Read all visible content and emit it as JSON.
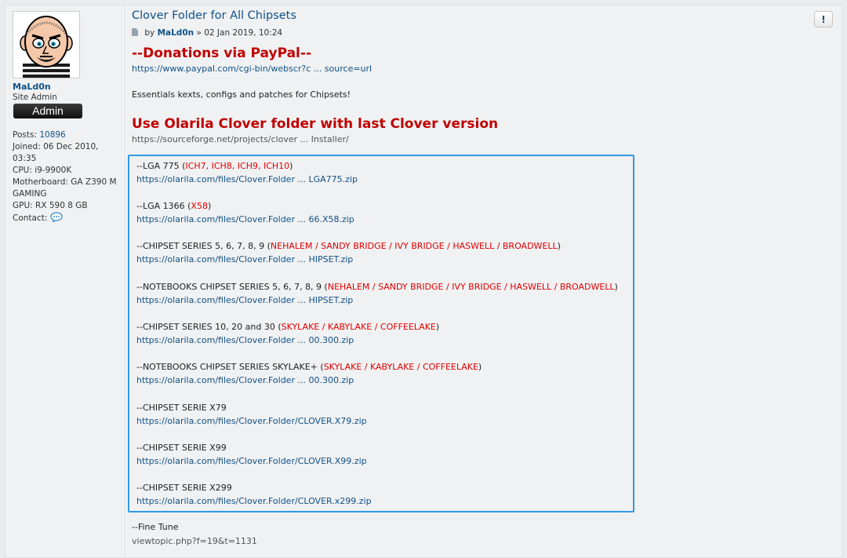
{
  "profile": {
    "username": "MaLd0n",
    "rank_title": "Site Admin",
    "rank_badge": "Admin",
    "posts_label": "Posts:",
    "posts_value": "10896",
    "joined": "Joined: 06 Dec 2010, 03:35",
    "cpu": "CPU: i9-9900K",
    "motherboard": "Motherboard: GA Z390 M GAMING",
    "gpu": "GPU: RX 590 8 GB",
    "contact_label": "Contact:"
  },
  "post": {
    "title": "Clover Folder for All Chipsets",
    "by": "by",
    "author": "MaLd0n",
    "date": "» 02 Jan 2019, 10:24",
    "report_label": "!",
    "donations_heading": "--Donations via PayPal--",
    "donations_link": "https://www.paypal.com/cgi-bin/webscr?c ... source=url",
    "intro": "Essentials kexts, configs and patches for Chipsets!",
    "clover_heading": "Use Olarila Clover folder with last Clover version",
    "clover_link": "https://sourceforge.net/projects/clover ... Installer/",
    "fine_tune_label": "--Fine Tune",
    "fine_tune_link": "viewtopic.php?f=19&t=1131"
  },
  "entries": [
    {
      "label": "--LGA 775 (",
      "red": "ICH7, ICH8, ICH9, ICH10",
      "close": ")",
      "url": "https://olarila.com/files/Clover.Folder ... LGA775.zip"
    },
    {
      "label": "--LGA 1366 (",
      "red": "X58",
      "close": ")",
      "url": "https://olarila.com/files/Clover.Folder ... 66.X58.zip"
    },
    {
      "label": "--CHIPSET SERIES 5, 6, 7, 8, 9 (",
      "red": "NEHALEM / SANDY BRIDGE / IVY BRIDGE / HASWELL / BROADWELL",
      "close": ")",
      "url": "https://olarila.com/files/Clover.Folder ... HIPSET.zip"
    },
    {
      "label": "--NOTEBOOKS CHIPSET SERIES 5, 6, 7, 8, 9 (",
      "red": "NEHALEM / SANDY BRIDGE / IVY BRIDGE / HASWELL / BROADWELL",
      "close": ")",
      "url": "https://olarila.com/files/Clover.Folder ... HIPSET.zip"
    },
    {
      "label": "--CHIPSET SERIES 10, 20 and 30 (",
      "red": "SKYLAKE / KABYLAKE / COFFEELAKE",
      "close": ")",
      "url": "https://olarila.com/files/Clover.Folder ... 00.300.zip"
    },
    {
      "label": "--NOTEBOOKS CHIPSET SERIES SKYLAKE+ (",
      "red": "SKYLAKE / KABYLAKE / COFFEELAKE",
      "close": ")",
      "url": "https://olarila.com/files/Clover.Folder ... 00.300.zip"
    },
    {
      "label": "--CHIPSET SERIE X79",
      "red": "",
      "close": "",
      "url": "https://olarila.com/files/Clover.Folder/CLOVER.X79.zip"
    },
    {
      "label": "--CHIPSET SERIE X99",
      "red": "",
      "close": "",
      "url": "https://olarila.com/files/Clover.Folder/CLOVER.X99.zip"
    },
    {
      "label": "--CHIPSET SERIE X299",
      "red": "",
      "close": "",
      "url": "https://olarila.com/files/Clover.Folder/CLOVER.x299.zip"
    }
  ],
  "colors": {
    "link": "#105289",
    "heading_red": "#c00000",
    "chipset_red": "#e00000",
    "highlight_box": "#2f9ae6"
  }
}
